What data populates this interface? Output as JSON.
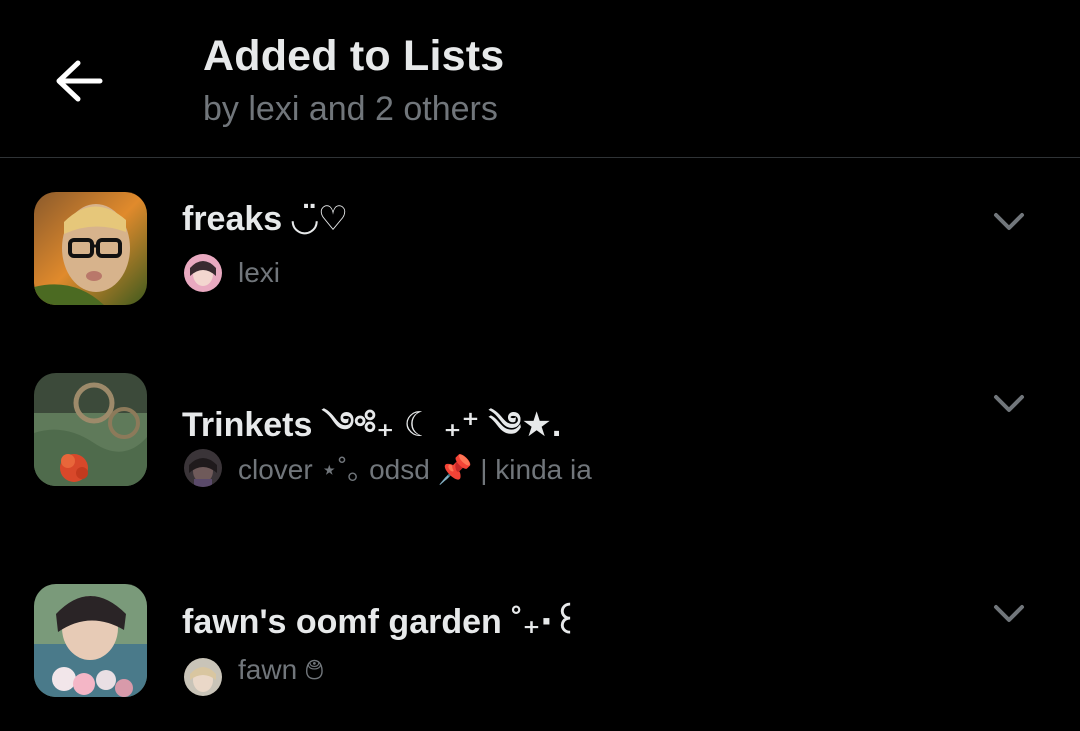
{
  "header": {
    "title": "Added to Lists",
    "subtitle": "by lexi and 2 others",
    "back_icon": "arrow-left-icon"
  },
  "lists": [
    {
      "name": "freaks ◡̈♡",
      "owner": "lexi",
      "menu_icon": "chevron-down-icon"
    },
    {
      "name": "Trinkets ༺₊ ☾ ₊⁺ ༄★.",
      "owner": "clover ⋆˚｡ odsd 📌 | kinda ia",
      "menu_icon": "chevron-down-icon"
    },
    {
      "name": "fawn's oomf garden ˚₊‧꒰",
      "owner": "fawn ࿉",
      "menu_icon": "chevron-down-icon"
    }
  ],
  "colors": {
    "background": "#000000",
    "primary_text": "#e7e9ea",
    "secondary_text": "#71767b",
    "divider": "#2f3336"
  }
}
